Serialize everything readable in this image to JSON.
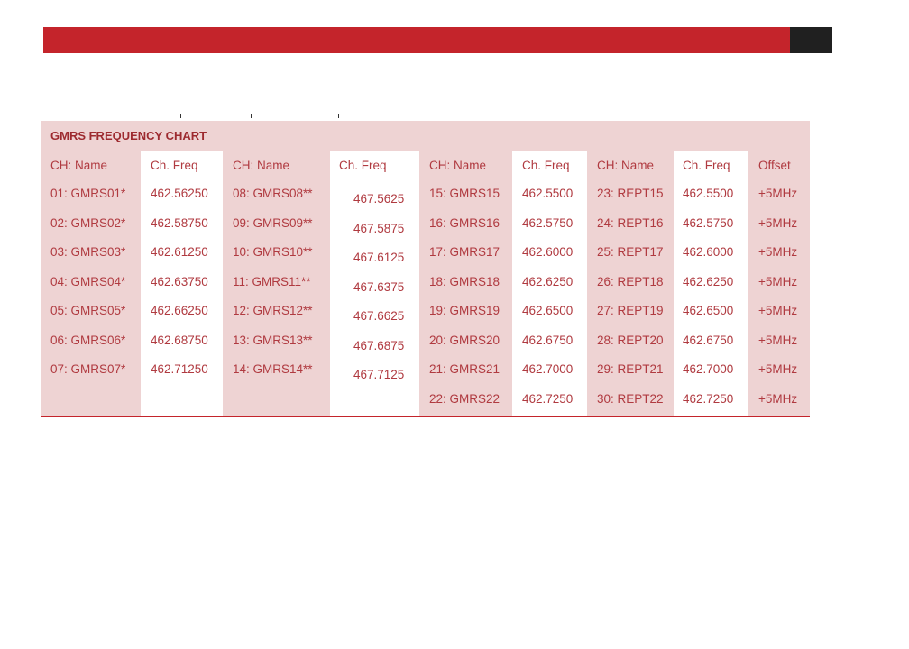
{
  "chart": {
    "title": "GMRS FREQUENCY CHART",
    "headers": [
      "CH: Name",
      "Ch. Freq",
      "CH: Name",
      "Ch. Freq",
      "CH: Name",
      "Ch. Freq",
      "CH: Name",
      "Ch. Freq",
      "Offset"
    ],
    "group1": {
      "names": [
        "01: GMRS01*",
        "02: GMRS02*",
        "03: GMRS03*",
        "04: GMRS04*",
        "05: GMRS05*",
        "06: GMRS06*",
        "07: GMRS07*"
      ],
      "freqs": [
        "462.56250",
        "462.58750",
        "462.61250",
        "462.63750",
        "462.66250",
        "462.68750",
        "462.71250"
      ]
    },
    "group2": {
      "names": [
        "08: GMRS08**",
        "09: GMRS09**",
        "10: GMRS10**",
        "11: GMRS11**",
        "12: GMRS12**",
        "13: GMRS13**",
        "14: GMRS14**"
      ],
      "freqs": [
        "467.5625",
        "467.5875",
        "467.6125",
        "467.6375",
        "467.6625",
        "467.6875",
        "467.7125"
      ]
    },
    "group3": {
      "names": [
        "15: GMRS15",
        "16: GMRS16",
        "17: GMRS17",
        "18: GMRS18",
        "19: GMRS19",
        "20: GMRS20",
        "21: GMRS21",
        "22: GMRS22"
      ],
      "freqs": [
        "462.5500",
        "462.5750",
        "462.6000",
        "462.6250",
        "462.6500",
        "462.6750",
        "462.7000",
        "462.7250"
      ]
    },
    "group4": {
      "names": [
        "23: REPT15",
        "24: REPT16",
        "25: REPT17",
        "26: REPT18",
        "27: REPT19",
        "28: REPT20",
        "29: REPT21",
        "30: REPT22"
      ],
      "freqs": [
        "462.5500",
        "462.5750",
        "462.6000",
        "462.6250",
        "462.6500",
        "462.6750",
        "462.7000",
        "462.7250"
      ],
      "offsets": [
        "+5MHz",
        "+5MHz",
        "+5MHz",
        "+5MHz",
        "+5MHz",
        "+5MHz",
        "+5MHz",
        "+5MHz"
      ]
    }
  },
  "colors": {
    "banner": "#c4242b",
    "banner_dark": "#202020",
    "table_bg": "#eed3d3",
    "text": "#b03a40"
  }
}
